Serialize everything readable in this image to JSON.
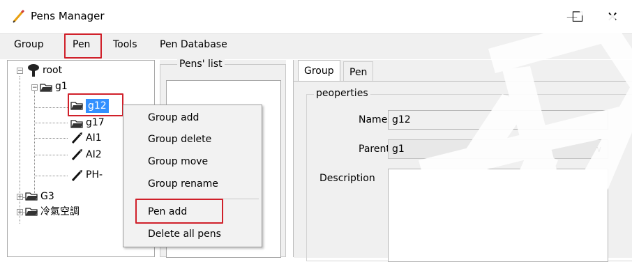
{
  "window": {
    "title": "Pens Manager",
    "minimize_glyph": "—",
    "maximize_glyph": "☐",
    "close_glyph": "✕"
  },
  "menu": [
    "Group",
    "Pen",
    "Tools",
    "Pen Database"
  ],
  "highlighted_menu": "Pen",
  "tree": {
    "root": "root",
    "items": [
      "g1",
      "g12",
      "g17",
      "AI1",
      "AI2",
      "PH-",
      "G3",
      "冷氣空調"
    ]
  },
  "pens_list": {
    "legend": "Pens' list"
  },
  "tabs": [
    "Group",
    "Pen"
  ],
  "properties": {
    "legend": "peoperties",
    "name_label": "Name",
    "name_value": "g12",
    "parent_label": "Parent",
    "parent_value": "g1",
    "description_label": "Description"
  },
  "context_menu": {
    "items": [
      "Group add",
      "Group delete",
      "Group move",
      "Group rename",
      "Pen add",
      "Delete all pens"
    ],
    "highlighted": "Pen add"
  },
  "colors": {
    "highlight": "#d0202a",
    "selection": "#3390ff",
    "menubar": "#f0f0f0"
  }
}
